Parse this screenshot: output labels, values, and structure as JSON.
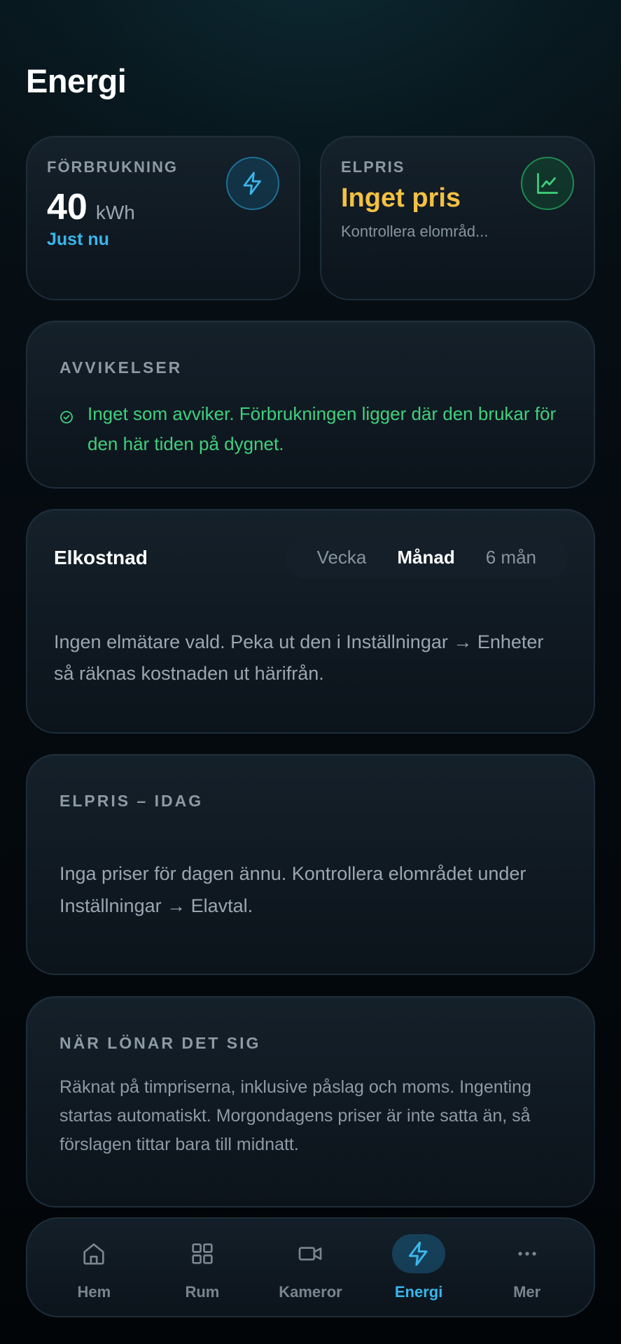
{
  "header": {
    "title": "Energi"
  },
  "usage_card": {
    "label": "FÖRBRUKNING",
    "value": "40",
    "unit": "kWh",
    "status": "Just nu",
    "icon": "lightning-icon"
  },
  "price_card": {
    "label": "ELPRIS",
    "value": "Inget pris",
    "subtitle": "Kontrollera elområd...",
    "icon": "chart-line-icon"
  },
  "deviations": {
    "label": "AVVIKELSER",
    "message": "Inget som avviker. Förbrukningen ligger där den brukar för den här tiden på dygnet.",
    "icon": "check-circle-icon"
  },
  "cost": {
    "title": "Elkostnad",
    "periods": [
      "Vecka",
      "Månad",
      "6 mån"
    ],
    "selected_period": "Månad",
    "message": "Ingen elmätare vald. Peka ut den i Inställningar → Enheter så räknas kostnaden ut härifrån."
  },
  "price_today": {
    "label": "ELPRIS – IDAG",
    "message": "Inga priser för dagen ännu. Kontrollera elområdet under Inställningar → Elavtal."
  },
  "when_profitable": {
    "label": "NÄR LÖNAR DET SIG",
    "message": "Räknat på timpriserna, inklusive påslag och moms. Ingenting startas automatiskt. Morgondagens priser är inte satta än, så förslagen tittar bara till midnatt."
  },
  "nav": {
    "items": [
      {
        "label": "Hem",
        "icon": "home-icon",
        "active": false
      },
      {
        "label": "Rum",
        "icon": "grid-icon",
        "active": false
      },
      {
        "label": "Kameror",
        "icon": "camera-icon",
        "active": false
      },
      {
        "label": "Energi",
        "icon": "lightning-icon",
        "active": true
      },
      {
        "label": "Mer",
        "icon": "more-icon",
        "active": false
      }
    ]
  },
  "colors": {
    "accent_blue": "#38b6ec",
    "accent_yellow": "#f4c142",
    "accent_green": "#3fd07d"
  }
}
